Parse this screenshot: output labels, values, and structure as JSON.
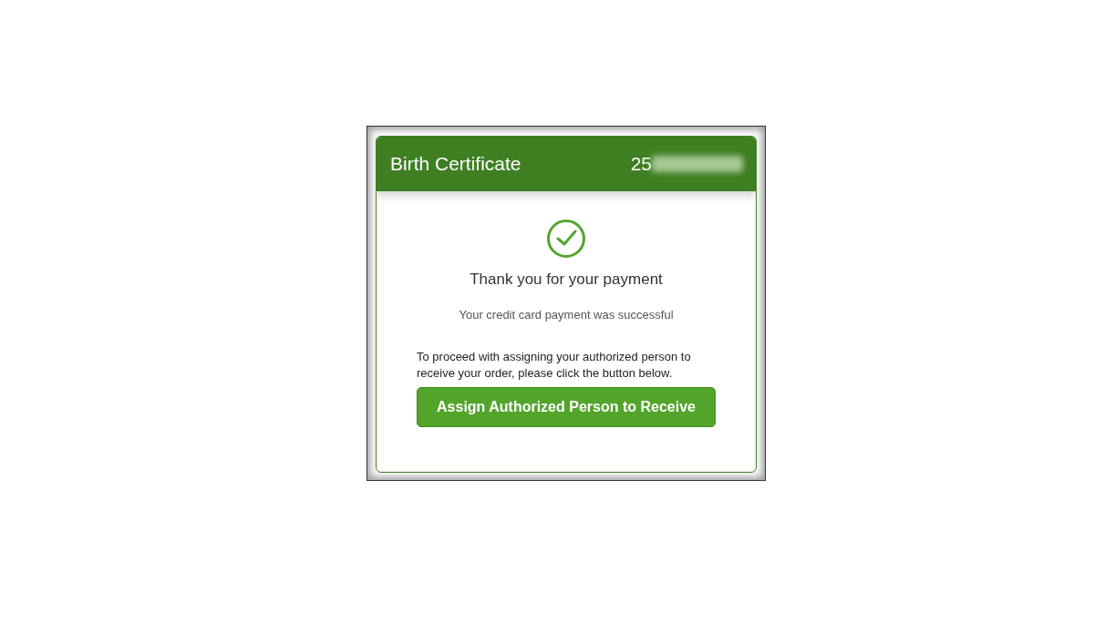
{
  "header": {
    "title": "Birth Certificate",
    "order_number": "25",
    "number_redacted": true
  },
  "status": {
    "kind": "success",
    "heading": "Thank you for your payment",
    "message": "Your credit card payment was successful"
  },
  "instructions": "To proceed with assigning your authorized person to receive your order, please click the button below.",
  "button": {
    "label": "Assign Authorized Person to Receive"
  }
}
